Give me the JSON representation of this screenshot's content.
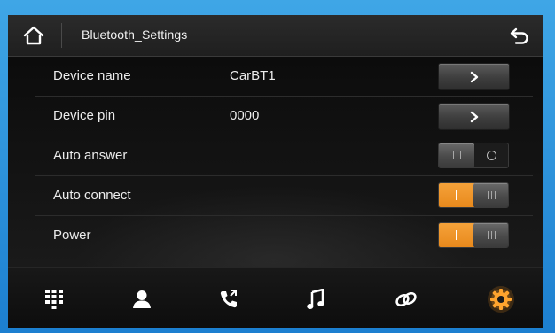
{
  "header": {
    "title": "Bluetooth_Settings",
    "home_icon": "home-icon",
    "back_icon": "back-arrow-icon"
  },
  "rows": [
    {
      "label": "Device name",
      "value": "CarBT1",
      "control": "arrow"
    },
    {
      "label": "Device pin",
      "value": "0000",
      "control": "arrow"
    },
    {
      "label": "Auto answer",
      "control": "toggle",
      "state": "off"
    },
    {
      "label": "Auto connect",
      "control": "toggle",
      "state": "on"
    },
    {
      "label": "Power",
      "control": "toggle",
      "state": "on"
    }
  ],
  "bottom_nav": [
    {
      "icon": "dialpad-icon",
      "active": false
    },
    {
      "icon": "contacts-icon",
      "active": false
    },
    {
      "icon": "call-log-icon",
      "active": false
    },
    {
      "icon": "music-icon",
      "active": false
    },
    {
      "icon": "link-icon",
      "active": false
    },
    {
      "icon": "settings-gear-icon",
      "active": true
    }
  ],
  "colors": {
    "frame": "#1c7fd0",
    "accent_orange": "#f0961f",
    "text": "#ececec",
    "background": "#101010"
  }
}
